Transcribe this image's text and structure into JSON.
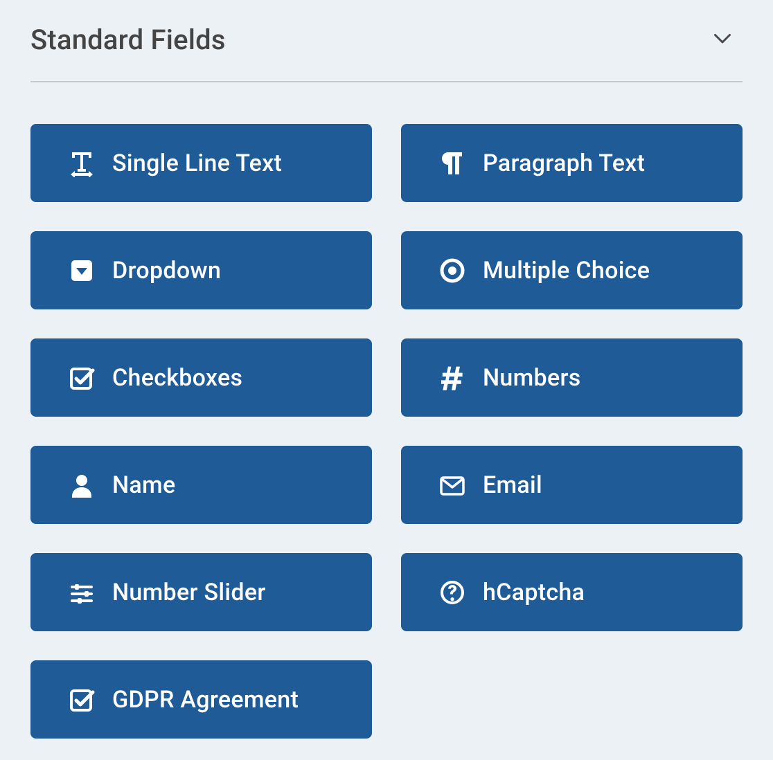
{
  "panel": {
    "title": "Standard Fields"
  },
  "fields": [
    {
      "id": "single-line-text",
      "label": "Single Line Text",
      "icon": "text-width-icon"
    },
    {
      "id": "paragraph-text",
      "label": "Paragraph Text",
      "icon": "pilcrow-icon"
    },
    {
      "id": "dropdown",
      "label": "Dropdown",
      "icon": "caret-square-down-icon"
    },
    {
      "id": "multiple-choice",
      "label": "Multiple Choice",
      "icon": "radio-dot-icon"
    },
    {
      "id": "checkboxes",
      "label": "Checkboxes",
      "icon": "check-square-icon"
    },
    {
      "id": "numbers",
      "label": "Numbers",
      "icon": "hash-icon"
    },
    {
      "id": "name",
      "label": "Name",
      "icon": "user-icon"
    },
    {
      "id": "email",
      "label": "Email",
      "icon": "envelope-icon"
    },
    {
      "id": "number-slider",
      "label": "Number Slider",
      "icon": "sliders-icon"
    },
    {
      "id": "hcaptcha",
      "label": "hCaptcha",
      "icon": "question-circle-icon"
    },
    {
      "id": "gdpr-agreement",
      "label": "GDPR Agreement",
      "icon": "check-square-icon"
    }
  ],
  "colors": {
    "background": "#ecf1f6",
    "button": "#1f5b96",
    "button_text": "#ffffff",
    "title": "#444444"
  }
}
